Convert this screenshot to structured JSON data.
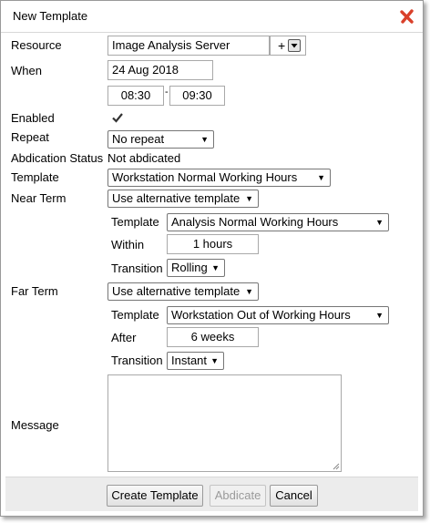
{
  "dialog": {
    "title": "New Template",
    "close_icon": "close-x-icon",
    "close_color": "#d9402a"
  },
  "labels": {
    "resource": "Resource",
    "when": "When",
    "enabled": "Enabled",
    "repeat": "Repeat",
    "abdication_status": "Abdication Status",
    "template": "Template",
    "near_term": "Near Term",
    "far_term": "Far Term",
    "message": "Message"
  },
  "resource": {
    "value": "Image Analysis Server",
    "add_label": "+"
  },
  "when": {
    "date": "24 Aug 2018",
    "start_time": "08:30",
    "separator": "-",
    "end_time": "09:30"
  },
  "enabled": {
    "checked": true
  },
  "repeat": {
    "selected": "No repeat"
  },
  "abdication_status": {
    "value": "Not abdicated"
  },
  "template": {
    "selected": "Workstation Normal Working Hours"
  },
  "near_term": {
    "mode": "Use alternative template",
    "template_label": "Template",
    "template": "Analysis Normal Working Hours",
    "within_label": "Within",
    "within": "1 hours",
    "transition_label": "Transition",
    "transition": "Rolling"
  },
  "far_term": {
    "mode": "Use alternative template",
    "template_label": "Template",
    "template": "Workstation Out of Working Hours",
    "after_label": "After",
    "after": "6 weeks",
    "transition_label": "Transition",
    "transition": "Instant"
  },
  "message": {
    "value": ""
  },
  "footer": {
    "create_label": "Create Template",
    "abdicate_label": "Abdicate",
    "cancel_label": "Cancel"
  }
}
